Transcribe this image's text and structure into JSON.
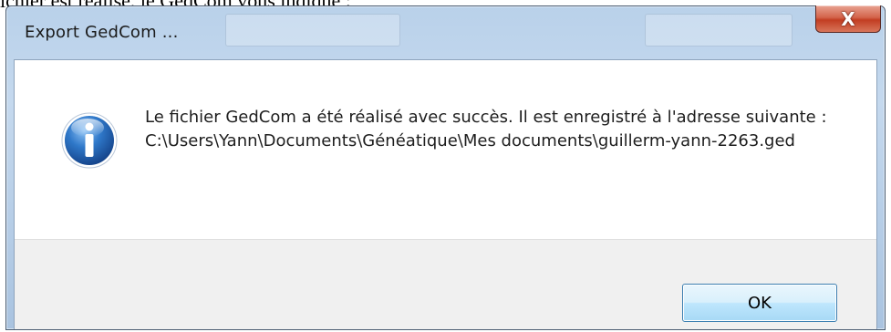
{
  "background": {
    "partial_text": "ichier est réalisé, le GedCom vous indique :"
  },
  "dialog": {
    "title": "Export GedCom ...",
    "close_label": "X",
    "message": "Le fichier GedCom a été réalisé avec succès. Il est enregistré à l'adresse suivante : C:\\Users\\Yann\\Documents\\Généatique\\Mes documents\\guillerm-yann-2263.ged",
    "ok_label": "OK",
    "icon": "information-icon"
  },
  "colors": {
    "titlebar": "#b9d1ea",
    "close_button": "#c23d22",
    "footer": "#f0f0f0",
    "ok_button_border": "#3c7fb1",
    "info_icon": "#1f5fae"
  }
}
